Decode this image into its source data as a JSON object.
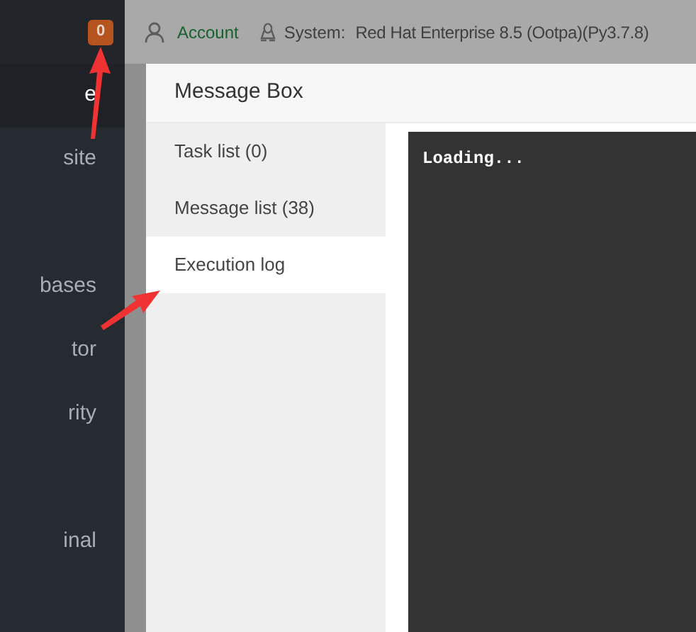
{
  "topbar": {
    "badge": "0",
    "account": "Account",
    "system_label": "System:",
    "system_value": "Red Hat Enterprise 8.5 (Ootpa)(Py3.7.8)"
  },
  "sidebar": {
    "items": [
      {
        "label": "e",
        "selected": true
      },
      {
        "label": "site",
        "selected": false
      },
      {
        "label": "bases",
        "selected": false
      },
      {
        "label": "tor",
        "selected": false
      },
      {
        "label": "rity",
        "selected": false
      },
      {
        "label": "inal",
        "selected": false
      }
    ]
  },
  "dialog": {
    "title": "Message Box",
    "tabs": [
      {
        "label": "Task list (0)",
        "selected": false
      },
      {
        "label": "Message list (38)",
        "selected": false
      },
      {
        "label": "Execution log",
        "selected": true
      }
    ],
    "log": "Loading..."
  }
}
